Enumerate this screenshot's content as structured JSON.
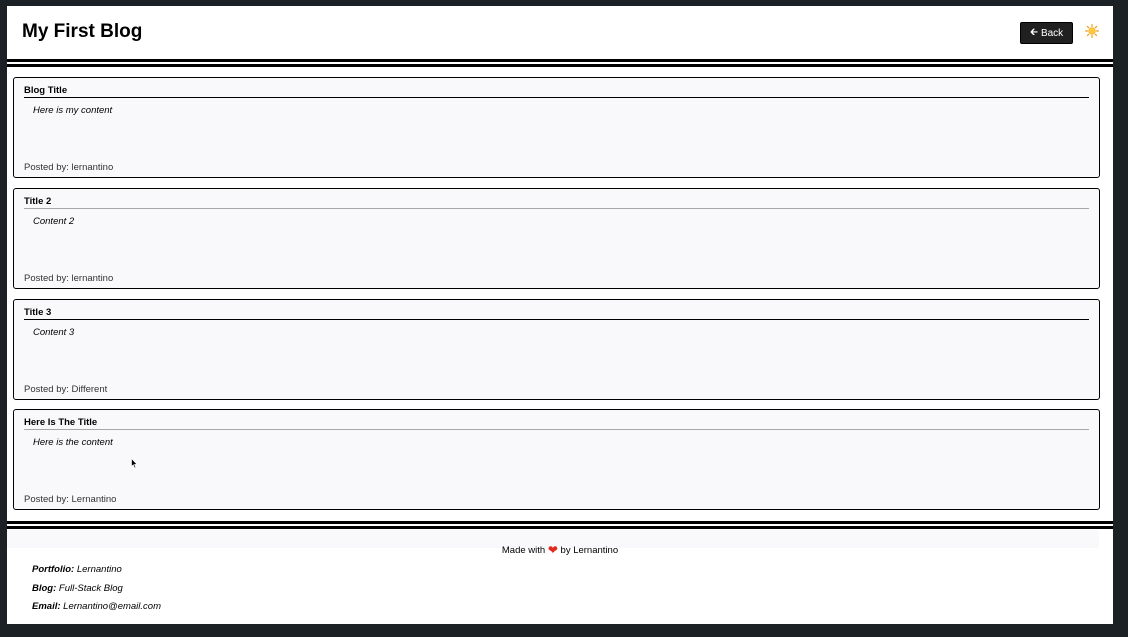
{
  "header": {
    "title": "My First Blog",
    "back_label": "Back",
    "back_icon": "arrow-left-icon",
    "theme_icon": "sun-icon"
  },
  "posts": [
    {
      "title": "Blog Title",
      "content": "Here is my content",
      "author": "Posted by: lernantino"
    },
    {
      "title": "Title 2",
      "content": "Content 2",
      "author": "Posted by: lernantino"
    },
    {
      "title": "Title 3",
      "content": "Content 3",
      "author": "Posted by: Different"
    },
    {
      "title": "Here Is The Title",
      "content": "Here is the content",
      "author": "Posted by: Lernantino"
    }
  ],
  "footer": {
    "made_with_prefix": "Made with",
    "made_with_suffix": "by Lernantino",
    "heart_icon": "heart-icon",
    "portfolio_label": "Portfolio:",
    "portfolio_value": "Lernantino",
    "blog_label": "Blog:",
    "blog_value": "Full-Stack Blog",
    "email_label": "Email:",
    "email_value": "Lernantino@email.com"
  },
  "colors": {
    "background": "#1c2126",
    "card": "#f9f9fb",
    "button": "#202020",
    "heart": "#e3281c"
  }
}
